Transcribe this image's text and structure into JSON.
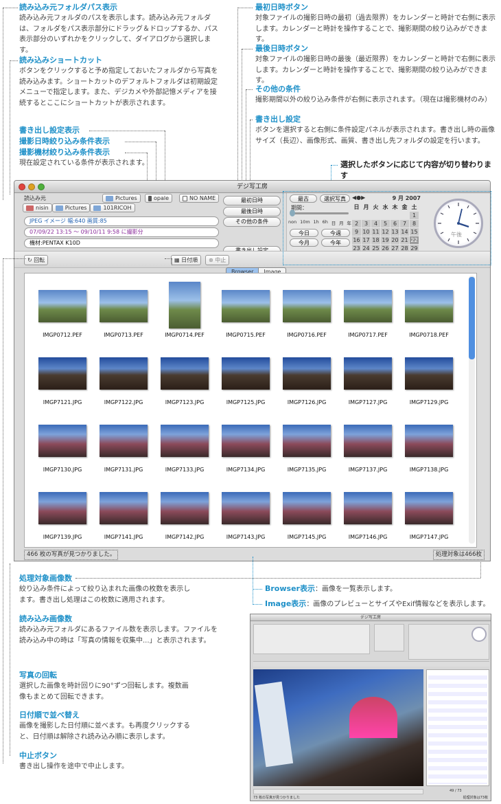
{
  "annotations": {
    "read_path": {
      "h": "読み込み元フォルダパス表示",
      "t": "読み込み元フォルダのパスを表示します。読み込み元フォルダは、フォルダをパス表示部分にドラッグ＆ドロップするか、パス表示部分のいずれかをクリックして、ダイアログから選択します。"
    },
    "read_shortcut": {
      "h": "読み込みショートカット",
      "t": "ボタンをクリックすると予め指定しておいたフォルダから写真を読み込みます。ショートカットのデフォルトフォルダは初期設定メニューで指定します。また、デジカメや外部記憶メディアを接続するとここにショートカットが表示されます。"
    },
    "export_display": {
      "h1": "書き出し設定表示",
      "h2": "撮影日時絞り込み条件表示",
      "h3": "撮影機材絞り込み条件表示",
      "t": "現在設定されている条件が表示されます。"
    },
    "first_date": {
      "h": "最初日時ボタン",
      "t": "対象ファイルの撮影日時の最初（過去限界）をカレンダーと時計で右側に表示します。カレンダーと時計を操作することで、撮影期間の絞り込みができます。"
    },
    "last_date": {
      "h": "最後日時ボタン",
      "t": "対象ファイルの撮影日時の最後（最近限界）をカレンダーと時計で右側に表示します。カレンダーと時計を操作することで、撮影期間の絞り込みができます。"
    },
    "other": {
      "h": "その他の条件",
      "t": "撮影期間以外の絞り込み条件が右側に表示されます。（現在は撮影機材のみ）"
    },
    "export": {
      "h": "書き出し設定",
      "t": "ボタンを選択すると右側に条件設定パネルが表示されます。書き出し時の画像サイズ（長辺）、画像形式、画質、書き出し先フォルダの設定を行います。"
    },
    "switch": {
      "t": "選択したボタンに応じて内容が切り替わります"
    },
    "target_count": {
      "h": "処理対象画像数",
      "t": "絞り込み条件によって絞り込まれた画像の枚数を表示します。書き出し処理はこの枚数に適用されます。"
    },
    "read_count": {
      "h": "読み込み画像数",
      "t": "読み込み元フォルダにあるファイル数を表示します。ファイルを読み込み中の時は「写真の情報を収集中...」と表示されます。"
    },
    "rotate": {
      "h": "写真の回転",
      "t": "選択した画像を時計回りに90°ずつ回転します。複数画像もまとめて回転できます。"
    },
    "sort": {
      "h": "日付順で並べ替え",
      "t": "画像を撮影した日付順に並べます。も再度クリックすると、日付順は解除され読み込み順に表示します。"
    },
    "stop": {
      "h": "中止ボタン",
      "t": "書き出し操作を途中で中止します。"
    },
    "browser_mode": {
      "h": "Browser表示",
      "t": "：画像を一覧表示します。"
    },
    "image_mode": {
      "h": "Image表示",
      "t": "：画像のプレビューとサイズやExif情報などを表示します。"
    }
  },
  "window": {
    "title": "デジ写工房",
    "read_label": "読込み元",
    "shortcuts": [
      "Pictures",
      "opale",
      "NO NAME"
    ],
    "path": [
      "nisin",
      "Pictures",
      "101RICOH"
    ],
    "export_info": "JPEG イメージ 幅:640 画質:85",
    "date_info": "07/09/22 13:15 〜 09/10/11 9:58 に撮影分",
    "equip_info": "機材:PENTAX K10D",
    "buttons": {
      "first": "最初日時",
      "last": "最後日時",
      "other": "その他の条件",
      "export": "書き出し設定"
    },
    "panel": {
      "newest": "最古",
      "select": "選択写真",
      "period": "期間：",
      "scale": [
        "non",
        "10m",
        "1h",
        "6h",
        "日",
        "月",
        "年"
      ],
      "today": "今日",
      "this_week": "今週",
      "this_month": "今月",
      "this_year": "今年",
      "month": "9 月 2007",
      "weekdays": [
        "日",
        "月",
        "火",
        "水",
        "木",
        "金",
        "土"
      ],
      "clock_label": "午後"
    },
    "toolbar": {
      "rotate": "回転",
      "sort": "日付順",
      "stop": "中止"
    },
    "tabs": {
      "browser": "Browser",
      "image": "Image"
    },
    "files": [
      "IMGP0712.PEF",
      "IMGP0713.PEF",
      "IMGP0714.PEF",
      "IMGP0715.PEF",
      "IMGP0716.PEF",
      "IMGP0717.PEF",
      "IMGP0718.PEF",
      "IMGP7121.JPG",
      "IMGP7122.JPG",
      "IMGP7123.JPG",
      "IMGP7125.JPG",
      "IMGP7126.JPG",
      "IMGP7127.JPG",
      "IMGP7129.JPG",
      "IMGP7130.JPG",
      "IMGP7131.JPG",
      "IMGP7133.JPG",
      "IMGP7134.JPG",
      "IMGP7135.JPG",
      "IMGP7137.JPG",
      "IMGP7138.JPG",
      "IMGP7139.JPG",
      "IMGP7141.JPG",
      "IMGP7142.JPG",
      "IMGP7143.JPG",
      "IMGP7145.JPG",
      "IMGP7146.JPG",
      "IMGP7147.JPG"
    ],
    "status_left": "466 枚の写真が見つかりました。",
    "status_right": "処理対象は466枚"
  },
  "shot2": {
    "title": "デジ写工房",
    "status": "73 枚の写真が見つかりました",
    "counter": "49 / 73",
    "target": "処理対象は73枚"
  }
}
